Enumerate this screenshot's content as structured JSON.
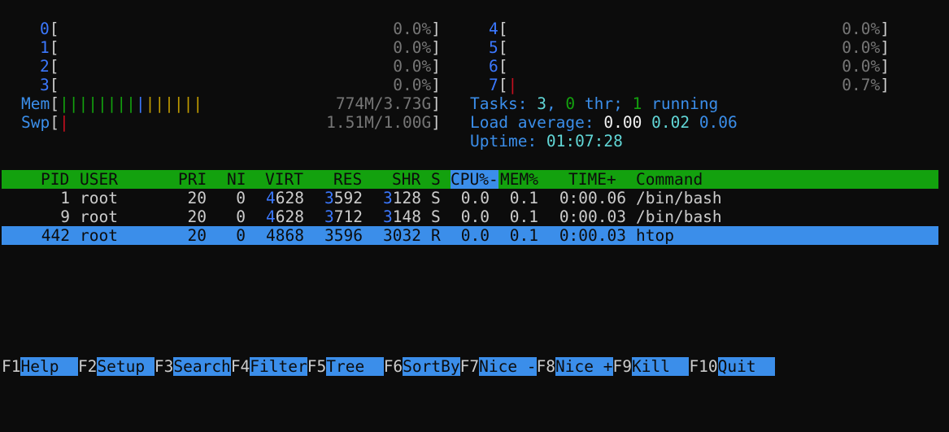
{
  "cpus_left": [
    {
      "num": "0",
      "value": "0.0%"
    },
    {
      "num": "1",
      "value": "0.0%"
    },
    {
      "num": "2",
      "value": "0.0%"
    },
    {
      "num": "3",
      "value": "0.0%"
    }
  ],
  "cpus_right": [
    {
      "num": "4",
      "value": "0.0%"
    },
    {
      "num": "5",
      "value": "0.0%"
    },
    {
      "num": "6",
      "value": "0.0%"
    },
    {
      "num": "7",
      "value": "0.7%"
    }
  ],
  "mem": {
    "label": "Mem",
    "value": "774M/3.73G"
  },
  "swp": {
    "label": "Swp",
    "value": "1.51M/1.00G"
  },
  "tasks": {
    "label": "Tasks: ",
    "count": "3",
    "sep": ", ",
    "thr": "0",
    "thr_label": " thr; ",
    "running": "1",
    "running_label": " running"
  },
  "load": {
    "label": "Load average: ",
    "one": "0.00",
    "five": "0.02",
    "fifteen": "0.06"
  },
  "uptime": {
    "label": "Uptime: ",
    "value": "01:07:28"
  },
  "columns": {
    "pid": "PID",
    "user": "USER",
    "pri": "PRI",
    "ni": "NI",
    "virt": "VIRT",
    "res": "RES",
    "shr": "SHR",
    "s": "S",
    "cpu": "CPU%",
    "cpu_arrow": "-",
    "mem": "MEM%",
    "time": "TIME+",
    "command": "Command"
  },
  "processes": [
    {
      "pid": "1",
      "user": "root",
      "pri": "20",
      "ni": "0",
      "virt_hi": "4",
      "virt_rest": "628",
      "res_hi": "3",
      "res_rest": "592",
      "shr_hi": "3",
      "shr_rest": "128",
      "s": "S",
      "cpu": "0.0",
      "mem": "0.1",
      "time": "0:00.06",
      "command": "/bin/bash"
    },
    {
      "pid": "9",
      "user": "root",
      "pri": "20",
      "ni": "0",
      "virt_hi": "4",
      "virt_rest": "628",
      "res_hi": "3",
      "res_rest": "712",
      "shr_hi": "3",
      "shr_rest": "148",
      "s": "S",
      "cpu": "0.0",
      "mem": "0.1",
      "time": "0:00.03",
      "command": "/bin/bash"
    },
    {
      "pid": "442",
      "user": "root",
      "pri": "20",
      "ni": "0",
      "virt_hi": "4",
      "virt_rest": "868",
      "res_hi": "3",
      "res_rest": "596",
      "shr_hi": "3",
      "shr_rest": "032",
      "s": "R",
      "cpu": "0.0",
      "mem": "0.1",
      "time": "0:00.03",
      "command": "htop"
    }
  ],
  "footer": [
    {
      "key": "F1",
      "label": "Help  "
    },
    {
      "key": "F2",
      "label": "Setup "
    },
    {
      "key": "F3",
      "label": "Search"
    },
    {
      "key": "F4",
      "label": "Filter"
    },
    {
      "key": "F5",
      "label": "Tree  "
    },
    {
      "key": "F6",
      "label": "SortBy"
    },
    {
      "key": "F7",
      "label": "Nice -"
    },
    {
      "key": "F8",
      "label": "Nice +"
    },
    {
      "key": "F9",
      "label": "Kill  "
    },
    {
      "key": "F10",
      "label": "Quit  "
    }
  ]
}
